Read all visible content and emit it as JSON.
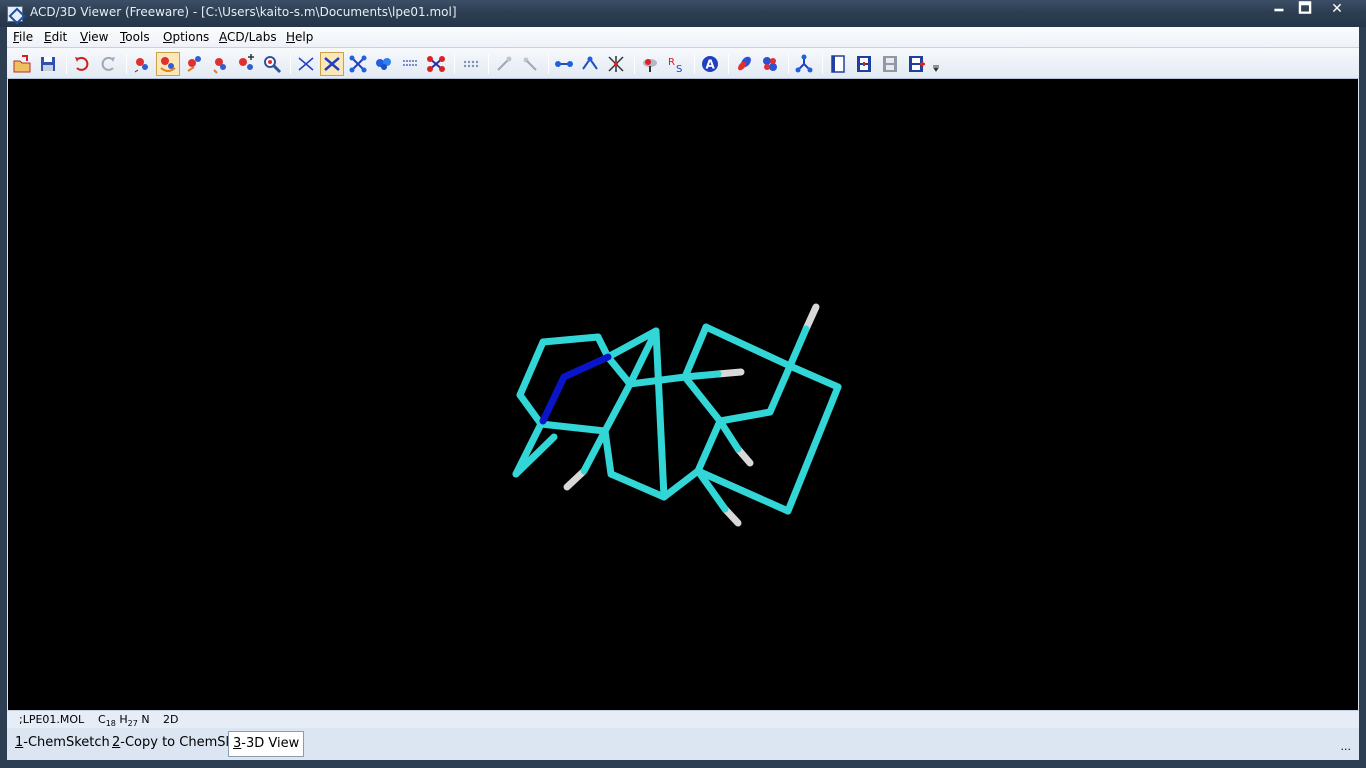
{
  "window": {
    "title": "ACD/3D Viewer (Freeware) - [C:\\Users\\kaito-s.m\\Documents\\lpe01.mol]",
    "minimize": "🗕",
    "maximize": "🗖",
    "close": "✕"
  },
  "menu": [
    {
      "u": "F",
      "rest": "ile"
    },
    {
      "u": "E",
      "rest": "dit"
    },
    {
      "u": "V",
      "rest": "iew"
    },
    {
      "u": "T",
      "rest": "ools"
    },
    {
      "u": "O",
      "rest": "ptions"
    },
    {
      "u": "A",
      "rest": "CD/Labs"
    },
    {
      "u": "H",
      "rest": "elp"
    }
  ],
  "toolbar_icons": [
    "open-icon",
    "save-icon",
    "undo-icon",
    "redo-icon",
    "rotate-3d-icon",
    "rotate-z-icon",
    "move-icon",
    "move-z-icon",
    "translate-icon",
    "zoom-icon",
    "wireframe-icon",
    "sticks-icon",
    "ball-stick-icon",
    "spacefill-icon",
    "dots-icon",
    "disks-icon",
    "surface-icon",
    "measure-distance-icon",
    "measure-angle-icon",
    "distance-icon",
    "angle-icon",
    "torsion-icon",
    "dihedral-icon",
    "stereo-rs-icon",
    "atom-label-icon",
    "orbital-icon",
    "orbital-2-icon",
    "fragment-icon",
    "page-icon",
    "film-icon",
    "film-gray-icon",
    "film-red-icon",
    "more-icon"
  ],
  "status": {
    "file": ";LPE01.MOL",
    "formula_c": "C",
    "formula_c_sub": "18",
    "formula_h": "H",
    "formula_h_sub": "27",
    "formula_n": "N",
    "mode": "2D"
  },
  "tabs": [
    {
      "num": "1",
      "label": "-ChemSketch",
      "selected": false
    },
    {
      "num": "2",
      "label": "-Copy to ChemSk",
      "selected": false
    },
    {
      "num": "3",
      "label": "-3D View",
      "selected": true
    }
  ],
  "tabbar_more": "...",
  "colors": {
    "carbon": "#33d6d6",
    "nitrogen": "#0a14c8",
    "hydrogen": "#d8d8d8",
    "background": "#000000"
  }
}
